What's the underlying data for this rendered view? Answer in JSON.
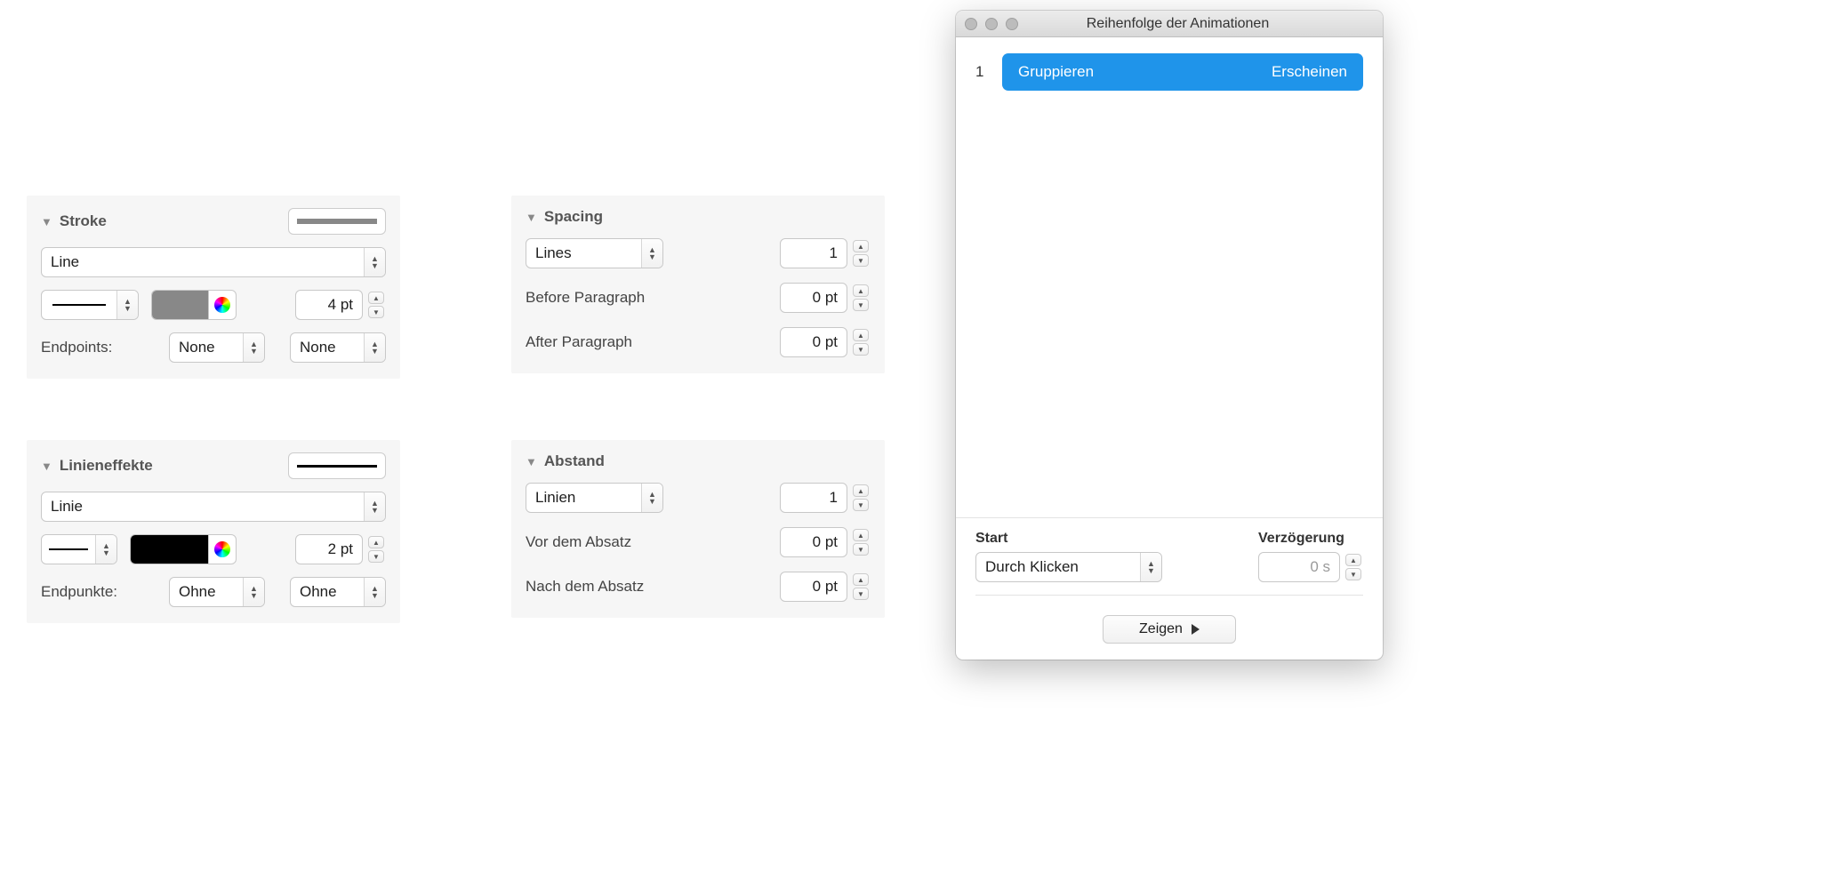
{
  "stroke_en": {
    "title": "Stroke",
    "type": "Line",
    "width": "4 pt",
    "endpoints_label": "Endpoints:",
    "endpoint_start": "None",
    "endpoint_end": "None",
    "color": "#888888"
  },
  "stroke_de": {
    "title": "Linieneffekte",
    "type": "Linie",
    "width": "2 pt",
    "endpoints_label": "Endpunkte:",
    "endpoint_start": "Ohne",
    "endpoint_end": "Ohne",
    "color": "#000000"
  },
  "spacing_en": {
    "title": "Spacing",
    "mode": "Lines",
    "mode_value": "1",
    "before_label": "Before Paragraph",
    "before_value": "0 pt",
    "after_label": "After Paragraph",
    "after_value": "0 pt"
  },
  "spacing_de": {
    "title": "Abstand",
    "mode": "Linien",
    "mode_value": "1",
    "before_label": "Vor dem Absatz",
    "before_value": "0 pt",
    "after_label": "Nach dem Absatz",
    "after_value": "0 pt"
  },
  "anim_window": {
    "title": "Reihenfolge der Animationen",
    "item_index": "1",
    "item_name": "Gruppieren",
    "item_effect": "Erscheinen",
    "start_label": "Start",
    "start_value": "Durch Klicken",
    "delay_label": "Verzögerung",
    "delay_value": "0 s",
    "show_button": "Zeigen"
  }
}
